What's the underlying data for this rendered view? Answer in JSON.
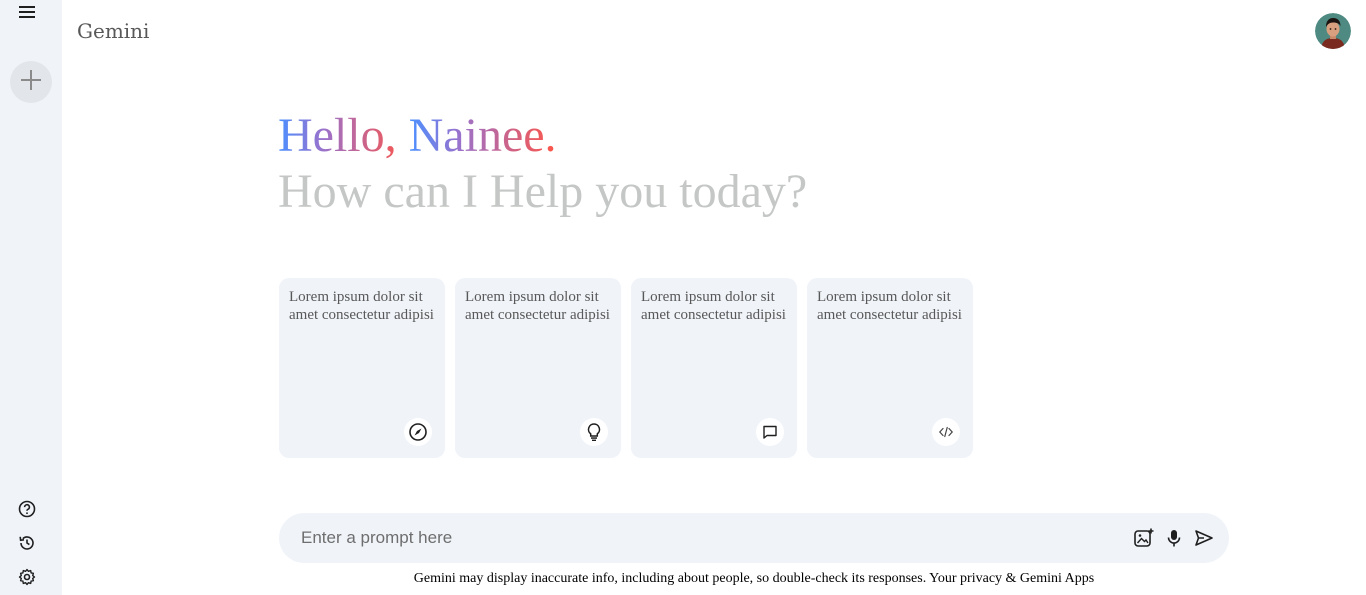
{
  "app": {
    "title": "Gemini"
  },
  "sidebar": {
    "menu_icon": "menu-icon",
    "new_chat_icon": "plus-icon",
    "bottom_items": [
      {
        "icon": "help-icon",
        "label": "Help"
      },
      {
        "icon": "history-icon",
        "label": "Activity"
      },
      {
        "icon": "settings-icon",
        "label": "Settings"
      }
    ]
  },
  "greeting": {
    "hello": "Hello, ",
    "name": "Nainee.",
    "subtitle": "How can I Help you today?"
  },
  "cards": [
    {
      "text": "Lorem ipsum dolor sit amet consectetur adipisi",
      "icon": "compass-icon"
    },
    {
      "text": "Lorem ipsum dolor sit amet consectetur adipisi",
      "icon": "bulb-icon"
    },
    {
      "text": "Lorem ipsum dolor sit amet consectetur adipisi",
      "icon": "message-icon"
    },
    {
      "text": "Lorem ipsum dolor sit amet consectetur adipisi",
      "icon": "code-icon"
    }
  ],
  "prompt": {
    "placeholder": "Enter a prompt here",
    "value": "",
    "icons": [
      "gallery-icon",
      "mic-icon",
      "send-icon"
    ]
  },
  "footer": {
    "disclaimer": "Gemini may display inaccurate info, including about people, so double-check its responses. Your privacy & Gemini Apps"
  },
  "colors": {
    "sidebar_bg": "#f0f4f9",
    "card_bg": "#f0f4f9",
    "greeting_gradient": [
      "#4b90ff",
      "#9b72cb",
      "#ff5546"
    ],
    "subtitle": "#c4c7c5"
  }
}
